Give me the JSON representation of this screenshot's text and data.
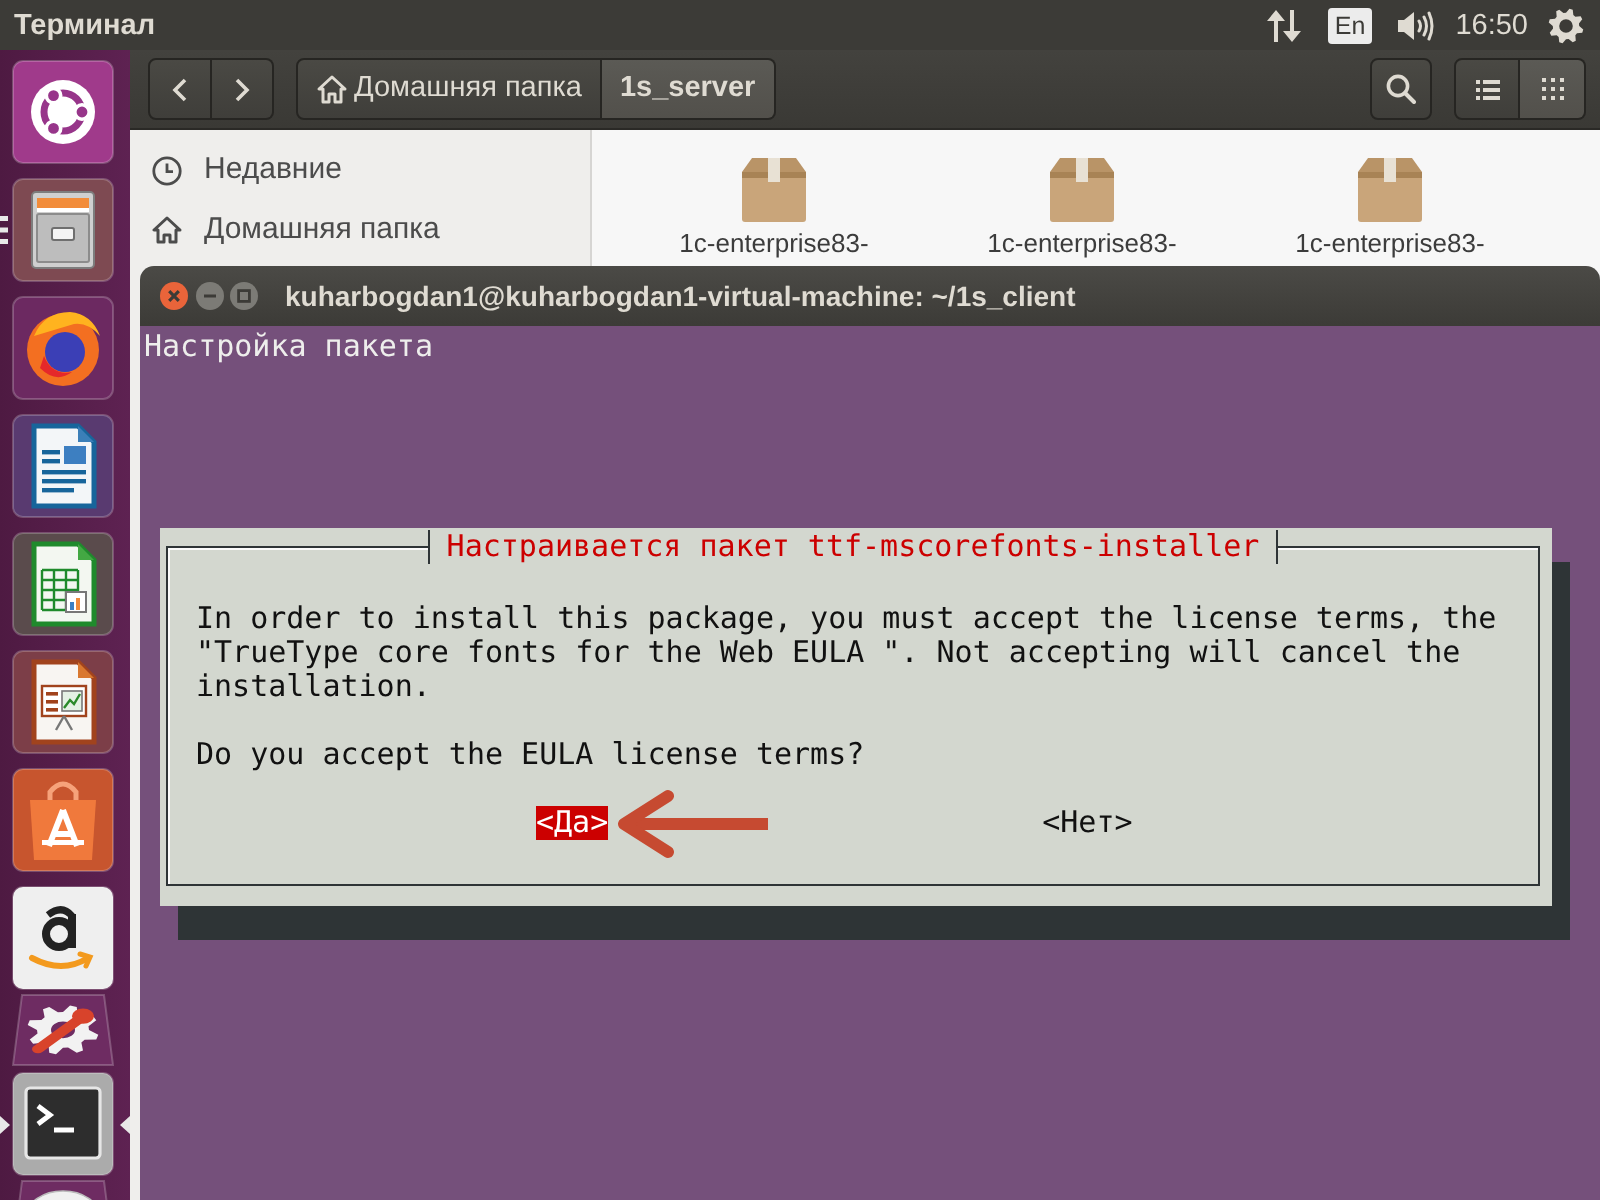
{
  "top_panel": {
    "title": "Терминал",
    "keyboard_layout": "En",
    "clock": "16:50"
  },
  "launcher": {
    "items": [
      {
        "kind": "dash",
        "running": false,
        "selected": false,
        "folded": false
      },
      {
        "kind": "file_manager",
        "running": true,
        "multiple_windows": true,
        "selected": false,
        "folded": false
      },
      {
        "kind": "browser",
        "running": false,
        "selected": false,
        "folded": false
      },
      {
        "kind": "word_processor",
        "running": false,
        "selected": false,
        "folded": false
      },
      {
        "kind": "spreadsheet",
        "running": false,
        "selected": false,
        "folded": false
      },
      {
        "kind": "presentation",
        "running": false,
        "selected": false,
        "folded": false
      },
      {
        "kind": "software_center",
        "running": false,
        "selected": false,
        "folded": false
      },
      {
        "kind": "shopping",
        "running": false,
        "selected": false,
        "folded": false
      },
      {
        "kind": "system_settings",
        "running": false,
        "selected": false,
        "folded": true
      },
      {
        "kind": "terminal",
        "running": true,
        "multiple_windows": false,
        "selected": true,
        "folded": false
      },
      {
        "kind": "disc",
        "running": false,
        "selected": false,
        "folded": true
      }
    ]
  },
  "file_manager": {
    "path": [
      {
        "kind": "home",
        "label": "Домашняя папка",
        "selected": false
      },
      {
        "kind": "folder",
        "label": "1s_server",
        "selected": true
      }
    ],
    "view_buttons": [
      {
        "kind": "list",
        "selected": false
      },
      {
        "kind": "grid",
        "selected": true
      }
    ],
    "sidebar": [
      {
        "kind": "recent",
        "label": "Недавние",
        "selected": false
      },
      {
        "kind": "home",
        "label": "Домашняя папка",
        "selected": false
      }
    ],
    "files": [
      {
        "kind": "package",
        "name": "1c-enterprise83-",
        "selected": false
      },
      {
        "kind": "package",
        "name": "1c-enterprise83-",
        "selected": false
      },
      {
        "kind": "package",
        "name": "1c-enterprise83-",
        "selected": false
      }
    ]
  },
  "terminal": {
    "title": "kuharbogdan1@kuharbogdan1-virtual-machine: ~/1s_client",
    "lines": [
      "Настройка пакета"
    ],
    "dialog": {
      "title": "Настраивается пакет ttf-mscorefonts-installer",
      "paragraphs": [
        "In order to install this package, you must accept the license terms, the \"TrueType core fonts for the Web EULA \". Not accepting will cancel the installation.",
        "Do you accept the EULA license terms?"
      ],
      "buttons": [
        {
          "label": "<Да>",
          "selected": true
        },
        {
          "label": "<Нет>",
          "selected": false
        }
      ]
    }
  }
}
